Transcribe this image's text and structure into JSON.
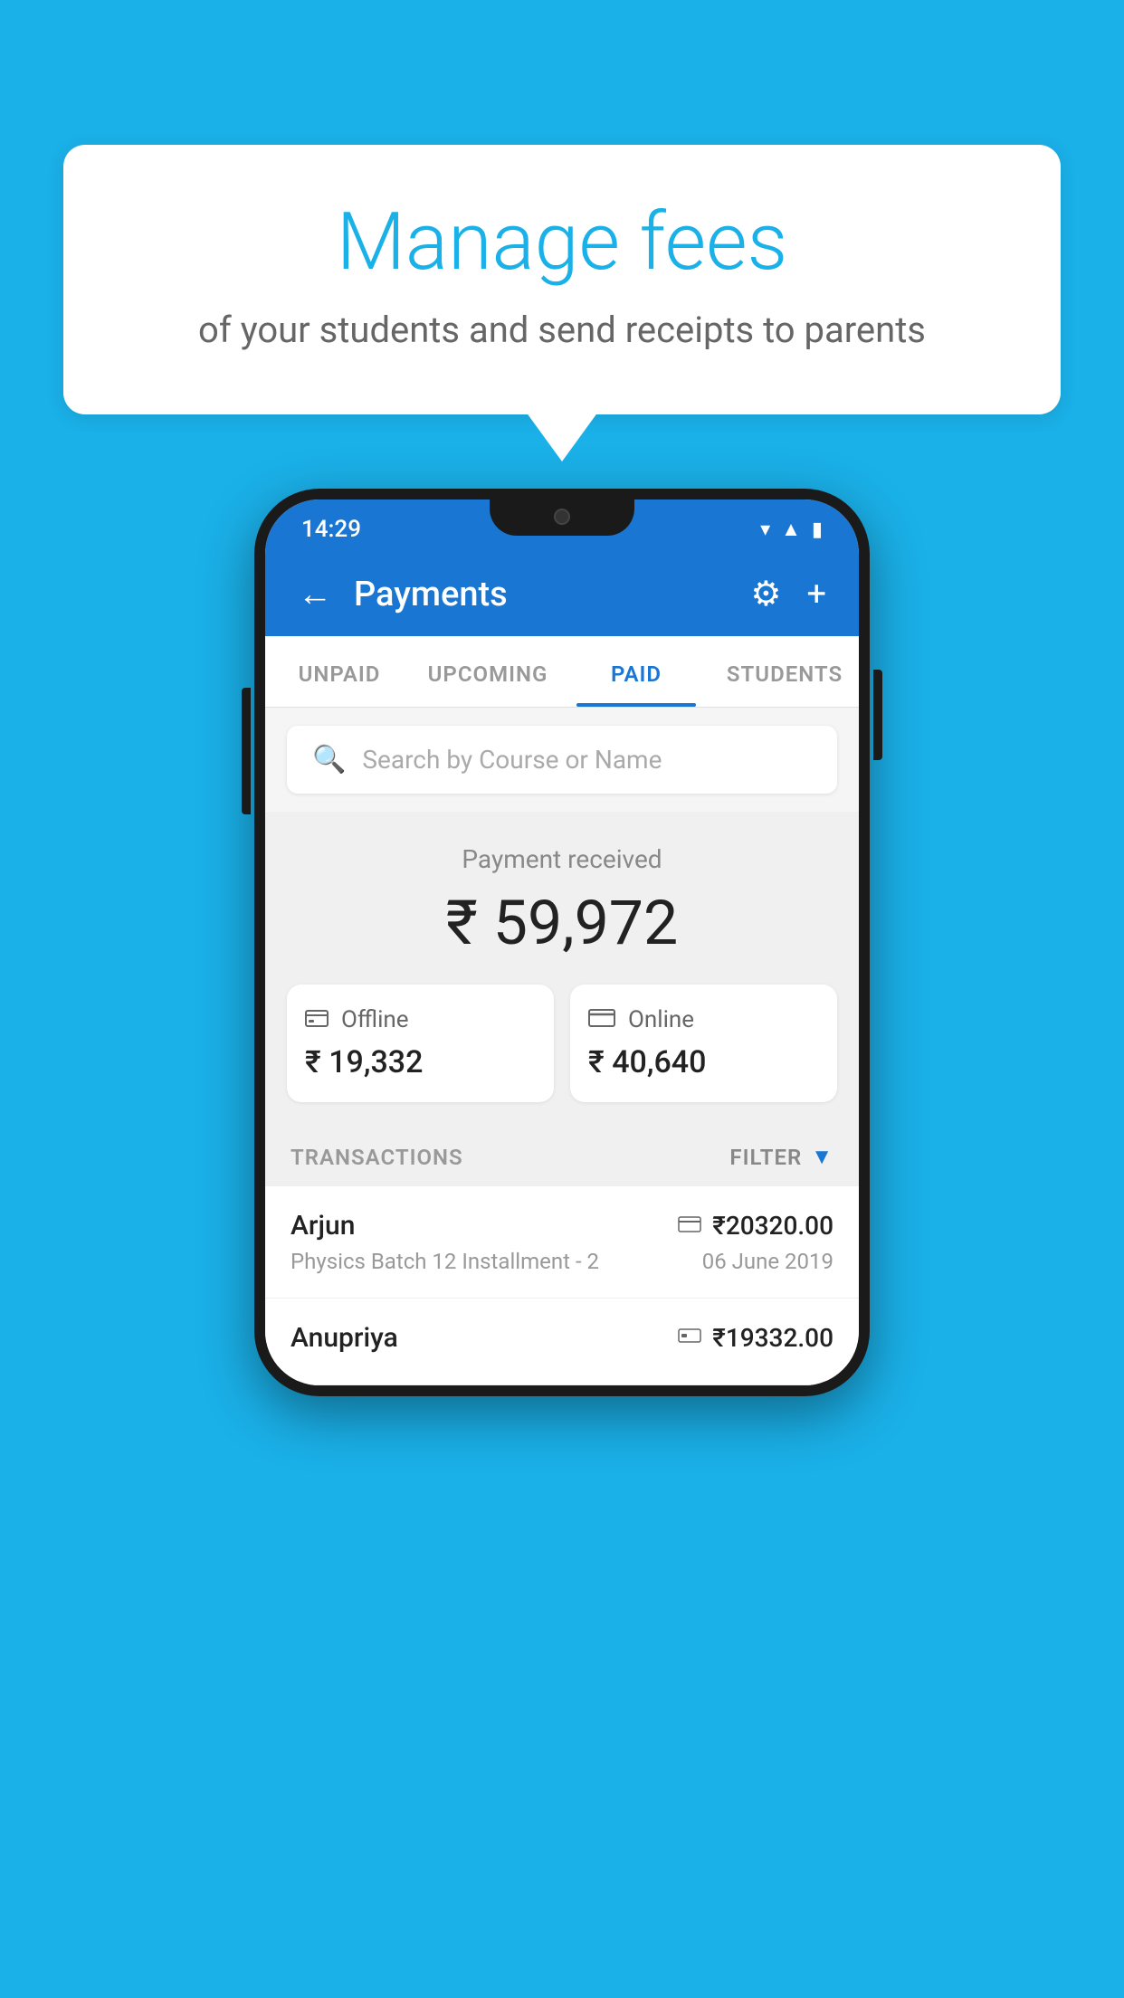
{
  "background_color": "#1ab0e8",
  "bubble": {
    "title": "Manage fees",
    "subtitle": "of your students and send receipts to parents"
  },
  "status_bar": {
    "time": "14:29",
    "icons": [
      "wifi",
      "signal",
      "battery"
    ]
  },
  "app_bar": {
    "title": "Payments",
    "back_label": "←",
    "settings_label": "⚙",
    "add_label": "+"
  },
  "tabs": [
    {
      "label": "UNPAID",
      "active": false
    },
    {
      "label": "UPCOMING",
      "active": false
    },
    {
      "label": "PAID",
      "active": true
    },
    {
      "label": "STUDENTS",
      "active": false
    }
  ],
  "search": {
    "placeholder": "Search by Course or Name"
  },
  "payment_summary": {
    "label": "Payment received",
    "amount": "₹ 59,972",
    "offline": {
      "type": "Offline",
      "amount": "₹ 19,332"
    },
    "online": {
      "type": "Online",
      "amount": "₹ 40,640"
    }
  },
  "transactions": {
    "header": "TRANSACTIONS",
    "filter_label": "FILTER",
    "rows": [
      {
        "name": "Arjun",
        "course": "Physics Batch 12 Installment - 2",
        "amount": "₹20320.00",
        "date": "06 June 2019",
        "icon": "card"
      },
      {
        "name": "Anupriya",
        "course": "",
        "amount": "₹19332.00",
        "date": "",
        "icon": "cash"
      }
    ]
  }
}
